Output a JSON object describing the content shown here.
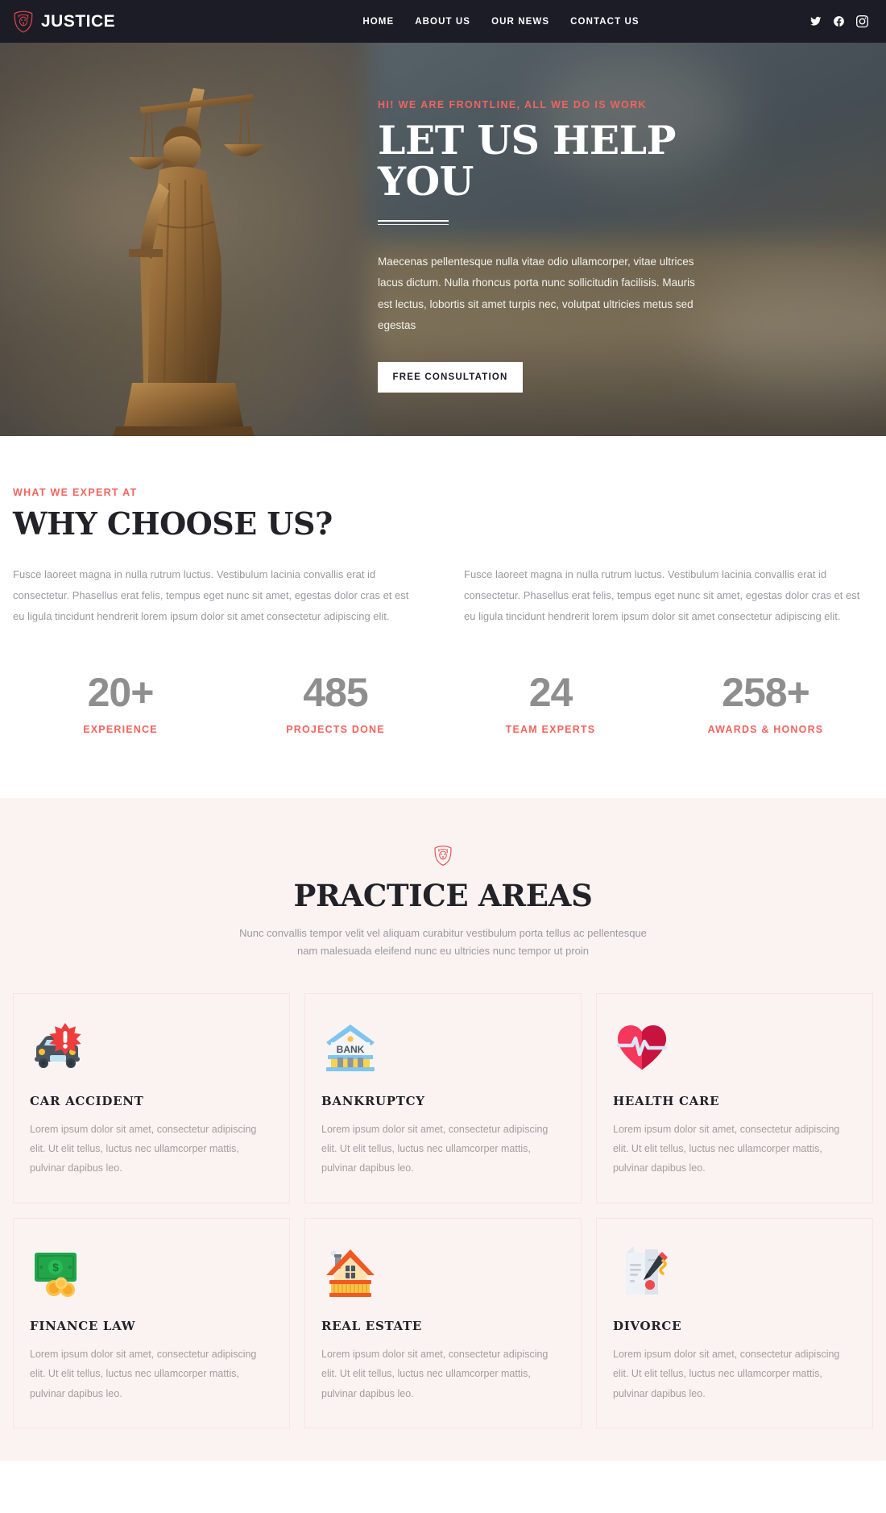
{
  "brand": {
    "name": "JUSTICE",
    "logo_icon": "lion-shield-icon",
    "accent": "#f2635f"
  },
  "nav": {
    "items": [
      {
        "label": "HOME"
      },
      {
        "label": "ABOUT US"
      },
      {
        "label": "OUR NEWS"
      },
      {
        "label": "CONTACT US"
      }
    ],
    "socials": [
      {
        "icon": "twitter-icon"
      },
      {
        "icon": "facebook-icon"
      },
      {
        "icon": "instagram-icon"
      }
    ]
  },
  "hero": {
    "kicker": "HI! WE ARE FRONTLINE, ALL WE DO IS WORK",
    "title": "LET US HELP YOU",
    "paragraph": "Maecenas pellentesque nulla vitae odio ullamcorper, vitae ultrices lacus dictum. Nulla rhoncus porta nunc sollicitudin facilisis. Mauris est lectus, lobortis sit amet turpis nec, volutpat ultricies metus sed egestas",
    "cta_label": "FREE CONSULTATION",
    "image_alt": "lady-justice-statue"
  },
  "why": {
    "kicker": "WHAT WE EXPERT AT",
    "title": "WHY CHOOSE US?",
    "columns": [
      "Fusce laoreet magna in nulla rutrum luctus. Vestibulum lacinia convallis erat id consectetur. Phasellus erat felis, tempus eget nunc sit amet, egestas dolor cras et est eu ligula tincidunt hendrerit lorem ipsum dolor sit amet consectetur adipiscing elit.",
      "Fusce laoreet magna in nulla rutrum luctus. Vestibulum lacinia convallis erat id consectetur. Phasellus erat felis, tempus eget nunc sit amet, egestas dolor cras et est eu ligula tincidunt hendrerit lorem ipsum dolor sit amet consectetur adipiscing elit."
    ],
    "stats": [
      {
        "number": "20+",
        "label": "EXPERIENCE"
      },
      {
        "number": "485",
        "label": "PROJECTS DONE"
      },
      {
        "number": "24",
        "label": "TEAM EXPERTS"
      },
      {
        "number": "258+",
        "label": "AWARDS & HONORS"
      }
    ]
  },
  "practice": {
    "emblem_icon": "lion-shield-icon",
    "title": "PRACTICE AREAS",
    "subtitle": "Nunc convallis tempor velit vel aliquam curabitur vestibulum porta tellus ac pellentesque nam malesuada eleifend nunc eu ultricies nunc tempor ut proin",
    "cards": [
      {
        "icon": "car-accident-icon",
        "title": "CAR ACCIDENT",
        "text": "Lorem ipsum dolor sit amet, consectetur adipiscing elit. Ut elit tellus, luctus nec ullamcorper mattis, pulvinar dapibus leo."
      },
      {
        "icon": "bank-building-icon",
        "title": "BANKRUPTCY",
        "text": "Lorem ipsum dolor sit amet, consectetur adipiscing elit. Ut elit tellus, luctus nec ullamcorper mattis, pulvinar dapibus leo."
      },
      {
        "icon": "heart-pulse-icon",
        "title": "HEALTH CARE",
        "text": "Lorem ipsum dolor sit amet, consectetur adipiscing elit. Ut elit tellus, luctus nec ullamcorper mattis, pulvinar dapibus leo."
      },
      {
        "icon": "money-coins-icon",
        "title": "FINANCE LAW",
        "text": "Lorem ipsum dolor sit amet, consectetur adipiscing elit. Ut elit tellus, luctus nec ullamcorper mattis, pulvinar dapibus leo."
      },
      {
        "icon": "house-icon",
        "title": "REAL ESTATE",
        "text": "Lorem ipsum dolor sit amet, consectetur adipiscing elit. Ut elit tellus, luctus nec ullamcorper mattis, pulvinar dapibus leo."
      },
      {
        "icon": "signed-document-icon",
        "title": "DIVORCE",
        "text": "Lorem ipsum dolor sit amet, consectetur adipiscing elit. Ut elit tellus, luctus nec ullamcorper mattis, pulvinar dapibus leo."
      }
    ]
  }
}
